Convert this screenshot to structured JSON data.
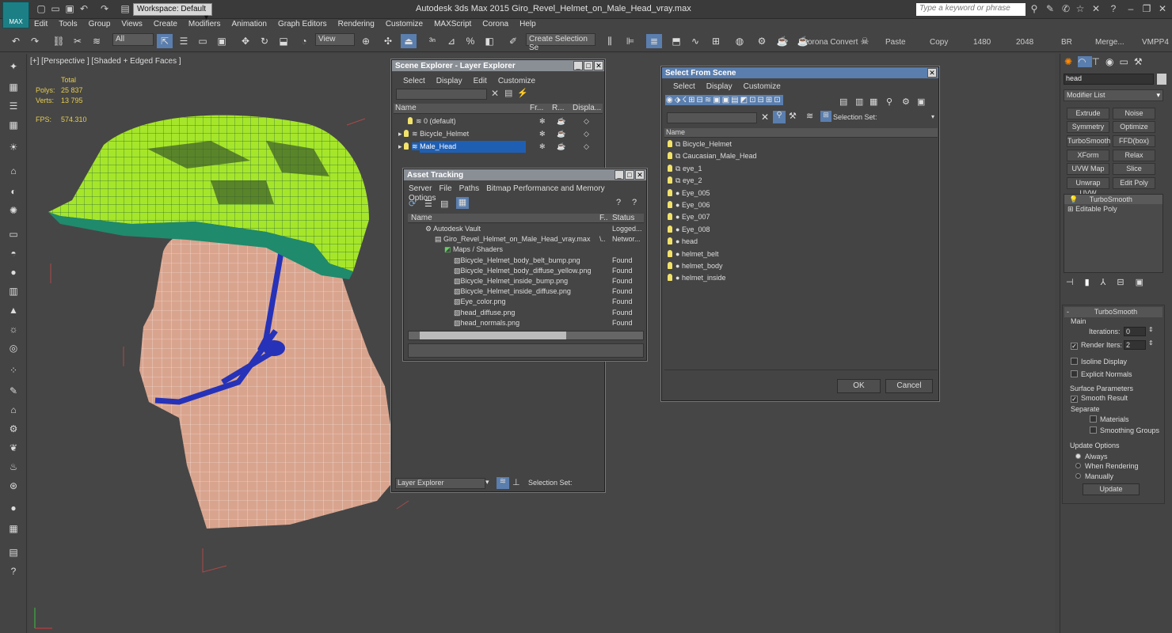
{
  "app": {
    "title": "Autodesk 3ds Max  2015    Giro_Revel_Helmet_on_Male_Head_vray.max",
    "logo_label": "MAX",
    "workspace": "Workspace: Default",
    "search_placeholder": "Type a keyword or phrase"
  },
  "menu": [
    "Edit",
    "Tools",
    "Group",
    "Views",
    "Create",
    "Modifiers",
    "Animation",
    "Graph Editors",
    "Rendering",
    "Customize",
    "MAXScript",
    "Corona",
    "Help"
  ],
  "toolbar": {
    "filter": "All",
    "refcoord": "View",
    "named_sel": "Create Selection Se",
    "corona_convert": "orona Convert",
    "paste": "Paste",
    "copy": "Copy",
    "w1480": "1480",
    "w2048": "2048",
    "br": "BR",
    "merge": "Merge...",
    "vmpp": "VMPP4"
  },
  "viewport": {
    "label": "[+] [Perspective ] [Shaded + Edged Faces ]",
    "total_label": "Total",
    "polys_label": "Polys:",
    "polys_value": "25 837",
    "verts_label": "Verts:",
    "verts_value": "13 795",
    "fps_label": "FPS:",
    "fps_value": "574.310"
  },
  "scene_explorer": {
    "title": "Scene Explorer - Layer Explorer",
    "menu": [
      "Select",
      "Display",
      "Edit",
      "Customize"
    ],
    "columns": [
      "Name",
      "Fr...",
      "R...",
      "Displa..."
    ],
    "rows": [
      {
        "name": "0 (default)",
        "selected": false
      },
      {
        "name": "Bicycle_Helmet",
        "selected": false
      },
      {
        "name": "Male_Head",
        "selected": true
      }
    ],
    "footer_dropdown": "Layer Explorer",
    "footer_selset": "Selection Set:"
  },
  "asset_tracking": {
    "title": "Asset Tracking",
    "menu": [
      "Server",
      "File",
      "Paths",
      "Bitmap Performance and Memory",
      "Options"
    ],
    "columns": [
      "Name",
      "F..",
      "Status"
    ],
    "rows": [
      {
        "name": "Autodesk Vault",
        "f": "",
        "status": "Logged...",
        "indent": 1
      },
      {
        "name": "Giro_Revel_Helmet_on_Male_Head_vray.max",
        "f": "\\..",
        "status": "Networ...",
        "indent": 2
      },
      {
        "name": "Maps / Shaders",
        "f": "",
        "status": "",
        "indent": 3
      },
      {
        "name": "Bicycle_Helmet_body_belt_bump.png",
        "f": "",
        "status": "Found",
        "indent": 4
      },
      {
        "name": "Bicycle_Helmet_body_diffuse_yellow.png",
        "f": "",
        "status": "Found",
        "indent": 4
      },
      {
        "name": "Bicycle_Helmet_inside_bump.png",
        "f": "",
        "status": "Found",
        "indent": 4
      },
      {
        "name": "Bicycle_Helmet_inside_diffuse.png",
        "f": "",
        "status": "Found",
        "indent": 4
      },
      {
        "name": "Eye_color.png",
        "f": "",
        "status": "Found",
        "indent": 4
      },
      {
        "name": "head_diffuse.png",
        "f": "",
        "status": "Found",
        "indent": 4
      },
      {
        "name": "head_normals.png",
        "f": "",
        "status": "Found",
        "indent": 4
      }
    ]
  },
  "select_from_scene": {
    "title": "Select From Scene",
    "menu": [
      "Select",
      "Display",
      "Customize"
    ],
    "selset": "Selection Set:",
    "column": "Name",
    "rows": [
      "Bicycle_Helmet",
      "Caucasian_Male_Head",
      "eye_1",
      "eye_2",
      "Eye_005",
      "Eye_006",
      "Eye_007",
      "Eye_008",
      "head",
      "helmet_belt",
      "helmet_body",
      "helmet_inside"
    ],
    "ok": "OK",
    "cancel": "Cancel"
  },
  "command_panel": {
    "object_name": "head",
    "modifier_list": "Modifier List",
    "modifier_buttons": [
      "Extrude",
      "Noise",
      "Symmetry",
      "Optimize",
      "TurboSmooth",
      "FFD(box)",
      "XForm",
      "Relax",
      "UVW Map",
      "Slice",
      "Unwrap UVW",
      "Edit Poly"
    ],
    "stack": [
      "TurboSmooth",
      "Editable Poly"
    ],
    "rollout_title": "TurboSmooth",
    "main_label": "Main",
    "iterations_label": "Iterations:",
    "iterations_value": "0",
    "render_iters_label": "Render Iters:",
    "render_iters_value": "2",
    "isoline": "Isoline Display",
    "explicit_normals": "Explicit Normals",
    "surface_params": "Surface Parameters",
    "smooth_result": "Smooth Result",
    "separate": "Separate",
    "materials": "Materials",
    "smoothing_groups": "Smoothing Groups",
    "update_options": "Update Options",
    "always": "Always",
    "when_rendering": "When Rendering",
    "manually": "Manually",
    "update": "Update"
  },
  "colors": {
    "helmet": "#a6e62a",
    "helmet_dark": "#1f8a6c",
    "skin": "#d9a48e",
    "strap": "#2632b8",
    "selection": "#1e5fb4"
  }
}
